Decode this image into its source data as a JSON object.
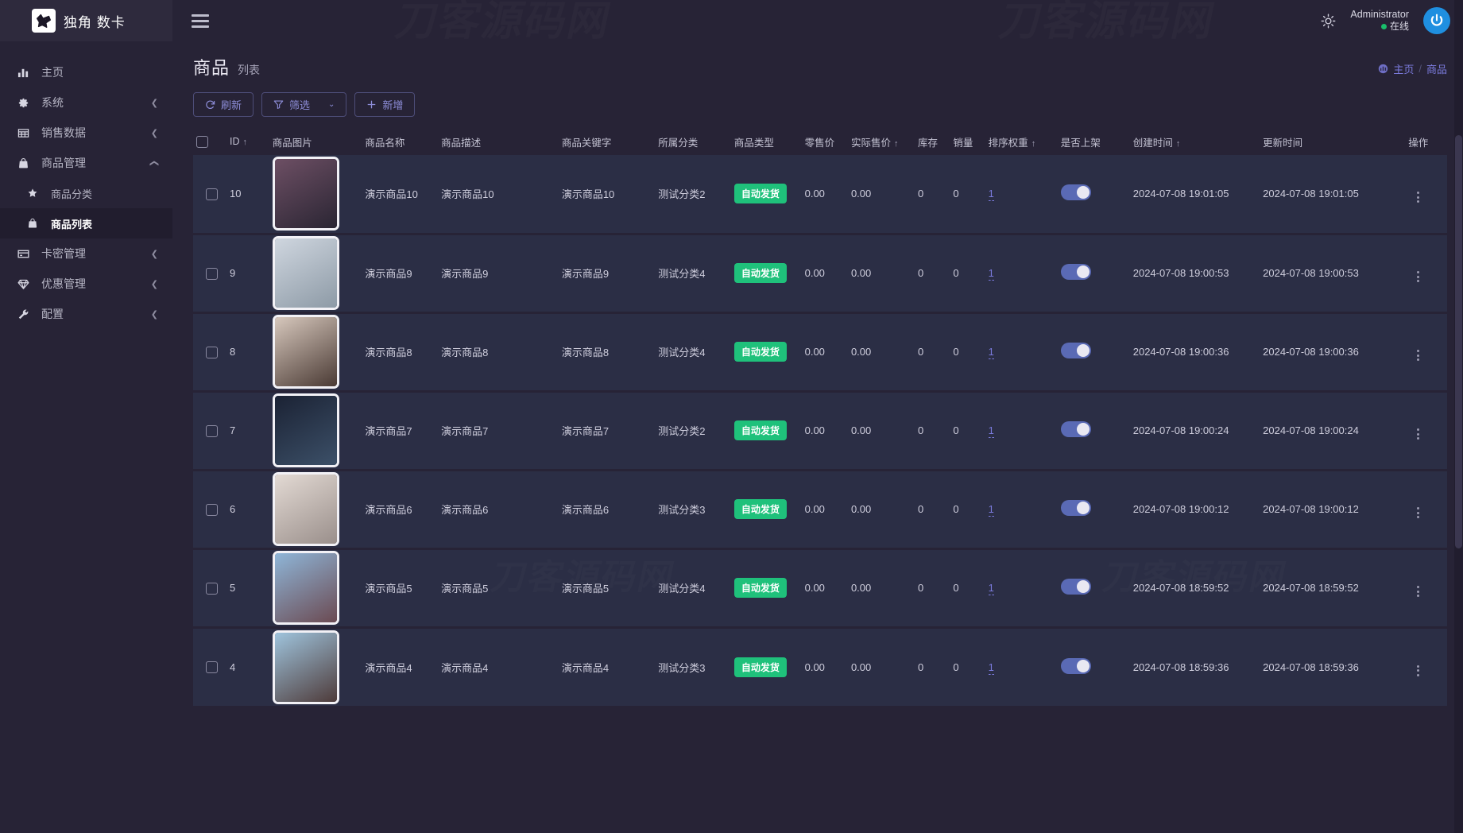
{
  "brand": {
    "name": "独角 数卡",
    "logo_icon": "unicorn-logo-icon"
  },
  "watermark": {
    "text": "刀客源码网"
  },
  "topbar": {
    "menu_toggle_icon": "hamburger-menu-icon",
    "theme_icon": "sun-icon",
    "user_name": "Administrator",
    "user_status": "在线",
    "avatar_icon": "power-avatar-icon"
  },
  "sidebar": {
    "items": [
      {
        "label": "主页",
        "icon": "chart-bar-icon",
        "expandable": false,
        "active": false,
        "sub": false
      },
      {
        "label": "系统",
        "icon": "gear-icon",
        "expandable": true,
        "expanded": false,
        "active": false,
        "sub": false
      },
      {
        "label": "销售数据",
        "icon": "table-grid-icon",
        "expandable": true,
        "expanded": false,
        "active": false,
        "sub": false
      },
      {
        "label": "商品管理",
        "icon": "bag-icon",
        "expandable": true,
        "expanded": true,
        "active": false,
        "sub": false
      },
      {
        "label": "商品分类",
        "icon": "star-icon",
        "expandable": false,
        "active": false,
        "sub": true
      },
      {
        "label": "商品列表",
        "icon": "bag-icon",
        "expandable": false,
        "active": true,
        "sub": true
      },
      {
        "label": "卡密管理",
        "icon": "card-icon",
        "expandable": true,
        "expanded": false,
        "active": false,
        "sub": false
      },
      {
        "label": "优惠管理",
        "icon": "diamond-icon",
        "expandable": true,
        "expanded": false,
        "active": false,
        "sub": false
      },
      {
        "label": "配置",
        "icon": "wrench-icon",
        "expandable": true,
        "expanded": false,
        "active": false,
        "sub": false
      }
    ],
    "collapse_chevron_icon": "chevron-left-icon",
    "expand_chevron_icon": "chevron-down-icon"
  },
  "page": {
    "title": "商品",
    "subtitle": "列表",
    "breadcrumb": {
      "home_icon": "home-dashboard-icon",
      "home": "主页",
      "separator": "/",
      "current": "商品"
    }
  },
  "toolbar": {
    "refresh_label": "刷新",
    "refresh_icon": "refresh-icon",
    "filter_label": "筛选",
    "filter_icon": "funnel-icon",
    "filter_caret_icon": "chevron-down-icon",
    "add_label": "新增",
    "add_icon": "plus-icon"
  },
  "table": {
    "select_all_icon": "checkbox-icon",
    "columns": [
      {
        "key": "checkbox",
        "label": "",
        "sortable": false
      },
      {
        "key": "id",
        "label": "ID",
        "sortable": true
      },
      {
        "key": "image",
        "label": "商品图片",
        "sortable": false
      },
      {
        "key": "name",
        "label": "商品名称",
        "sortable": false
      },
      {
        "key": "description",
        "label": "商品描述",
        "sortable": false
      },
      {
        "key": "keyword",
        "label": "商品关键字",
        "sortable": false
      },
      {
        "key": "category",
        "label": "所属分类",
        "sortable": false
      },
      {
        "key": "type",
        "label": "商品类型",
        "sortable": false
      },
      {
        "key": "retail_price",
        "label": "零售价",
        "sortable": false
      },
      {
        "key": "actual_price",
        "label": "实际售价",
        "sortable": true
      },
      {
        "key": "stock",
        "label": "库存",
        "sortable": false
      },
      {
        "key": "sales",
        "label": "销量",
        "sortable": false
      },
      {
        "key": "weight",
        "label": "排序权重",
        "sortable": true
      },
      {
        "key": "on_shelf",
        "label": "是否上架",
        "sortable": false
      },
      {
        "key": "created_at",
        "label": "创建时间",
        "sortable": true
      },
      {
        "key": "updated_at",
        "label": "更新时间",
        "sortable": false
      },
      {
        "key": "actions",
        "label": "操作",
        "sortable": false
      }
    ],
    "sort_asc_icon": "arrow-up-icon",
    "row_action_icon": "vertical-dots-icon",
    "rows": [
      {
        "id": "10",
        "name": "演示商品10",
        "description": "演示商品10",
        "keyword": "演示商品10",
        "category": "测试分类2",
        "type": "自动发货",
        "retail_price": "0.00",
        "actual_price": "0.00",
        "stock": "0",
        "sales": "0",
        "weight": "1",
        "on_shelf": true,
        "created_at": "2024-07-08 19:01:05",
        "updated_at": "2024-07-08 19:01:05",
        "thumb_from": "#6d4f64",
        "thumb_to": "#2a2533"
      },
      {
        "id": "9",
        "name": "演示商品9",
        "description": "演示商品9",
        "keyword": "演示商品9",
        "category": "测试分类4",
        "type": "自动发货",
        "retail_price": "0.00",
        "actual_price": "0.00",
        "stock": "0",
        "sales": "0",
        "weight": "1",
        "on_shelf": true,
        "created_at": "2024-07-08 19:00:53",
        "updated_at": "2024-07-08 19:00:53",
        "thumb_from": "#cfd6df",
        "thumb_to": "#8d9aa6"
      },
      {
        "id": "8",
        "name": "演示商品8",
        "description": "演示商品8",
        "keyword": "演示商品8",
        "category": "测试分类4",
        "type": "自动发货",
        "retail_price": "0.00",
        "actual_price": "0.00",
        "stock": "0",
        "sales": "0",
        "weight": "1",
        "on_shelf": true,
        "created_at": "2024-07-08 19:00:36",
        "updated_at": "2024-07-08 19:00:36",
        "thumb_from": "#d7c8bd",
        "thumb_to": "#4a3a34"
      },
      {
        "id": "7",
        "name": "演示商品7",
        "description": "演示商品7",
        "keyword": "演示商品7",
        "category": "测试分类2",
        "type": "自动发货",
        "retail_price": "0.00",
        "actual_price": "0.00",
        "stock": "0",
        "sales": "0",
        "weight": "1",
        "on_shelf": true,
        "created_at": "2024-07-08 19:00:24",
        "updated_at": "2024-07-08 19:00:24",
        "thumb_from": "#1b2234",
        "thumb_to": "#3c5068"
      },
      {
        "id": "6",
        "name": "演示商品6",
        "description": "演示商品6",
        "keyword": "演示商品6",
        "category": "测试分类3",
        "type": "自动发货",
        "retail_price": "0.00",
        "actual_price": "0.00",
        "stock": "0",
        "sales": "0",
        "weight": "1",
        "on_shelf": true,
        "created_at": "2024-07-08 19:00:12",
        "updated_at": "2024-07-08 19:00:12",
        "thumb_from": "#e3dad4",
        "thumb_to": "#9a8f8b"
      },
      {
        "id": "5",
        "name": "演示商品5",
        "description": "演示商品5",
        "keyword": "演示商品5",
        "category": "测试分类4",
        "type": "自动发货",
        "retail_price": "0.00",
        "actual_price": "0.00",
        "stock": "0",
        "sales": "0",
        "weight": "1",
        "on_shelf": true,
        "created_at": "2024-07-08 18:59:52",
        "updated_at": "2024-07-08 18:59:52",
        "thumb_from": "#8fb6d8",
        "thumb_to": "#6b4a52"
      },
      {
        "id": "4",
        "name": "演示商品4",
        "description": "演示商品4",
        "keyword": "演示商品4",
        "category": "测试分类3",
        "type": "自动发货",
        "retail_price": "0.00",
        "actual_price": "0.00",
        "stock": "0",
        "sales": "0",
        "weight": "1",
        "on_shelf": true,
        "created_at": "2024-07-08 18:59:36",
        "updated_at": "2024-07-08 18:59:36",
        "thumb_from": "#9fc4dd",
        "thumb_to": "#4e3b3a"
      }
    ]
  },
  "colors": {
    "sidebar_bg": "#272336",
    "row_bg": "#2b2e45",
    "accent": "#7b7bdd",
    "badge_green": "#1fc17b",
    "toggle_on": "#5a6ab5",
    "online_green": "#19be6b",
    "avatar_blue": "#1f8fe0"
  }
}
